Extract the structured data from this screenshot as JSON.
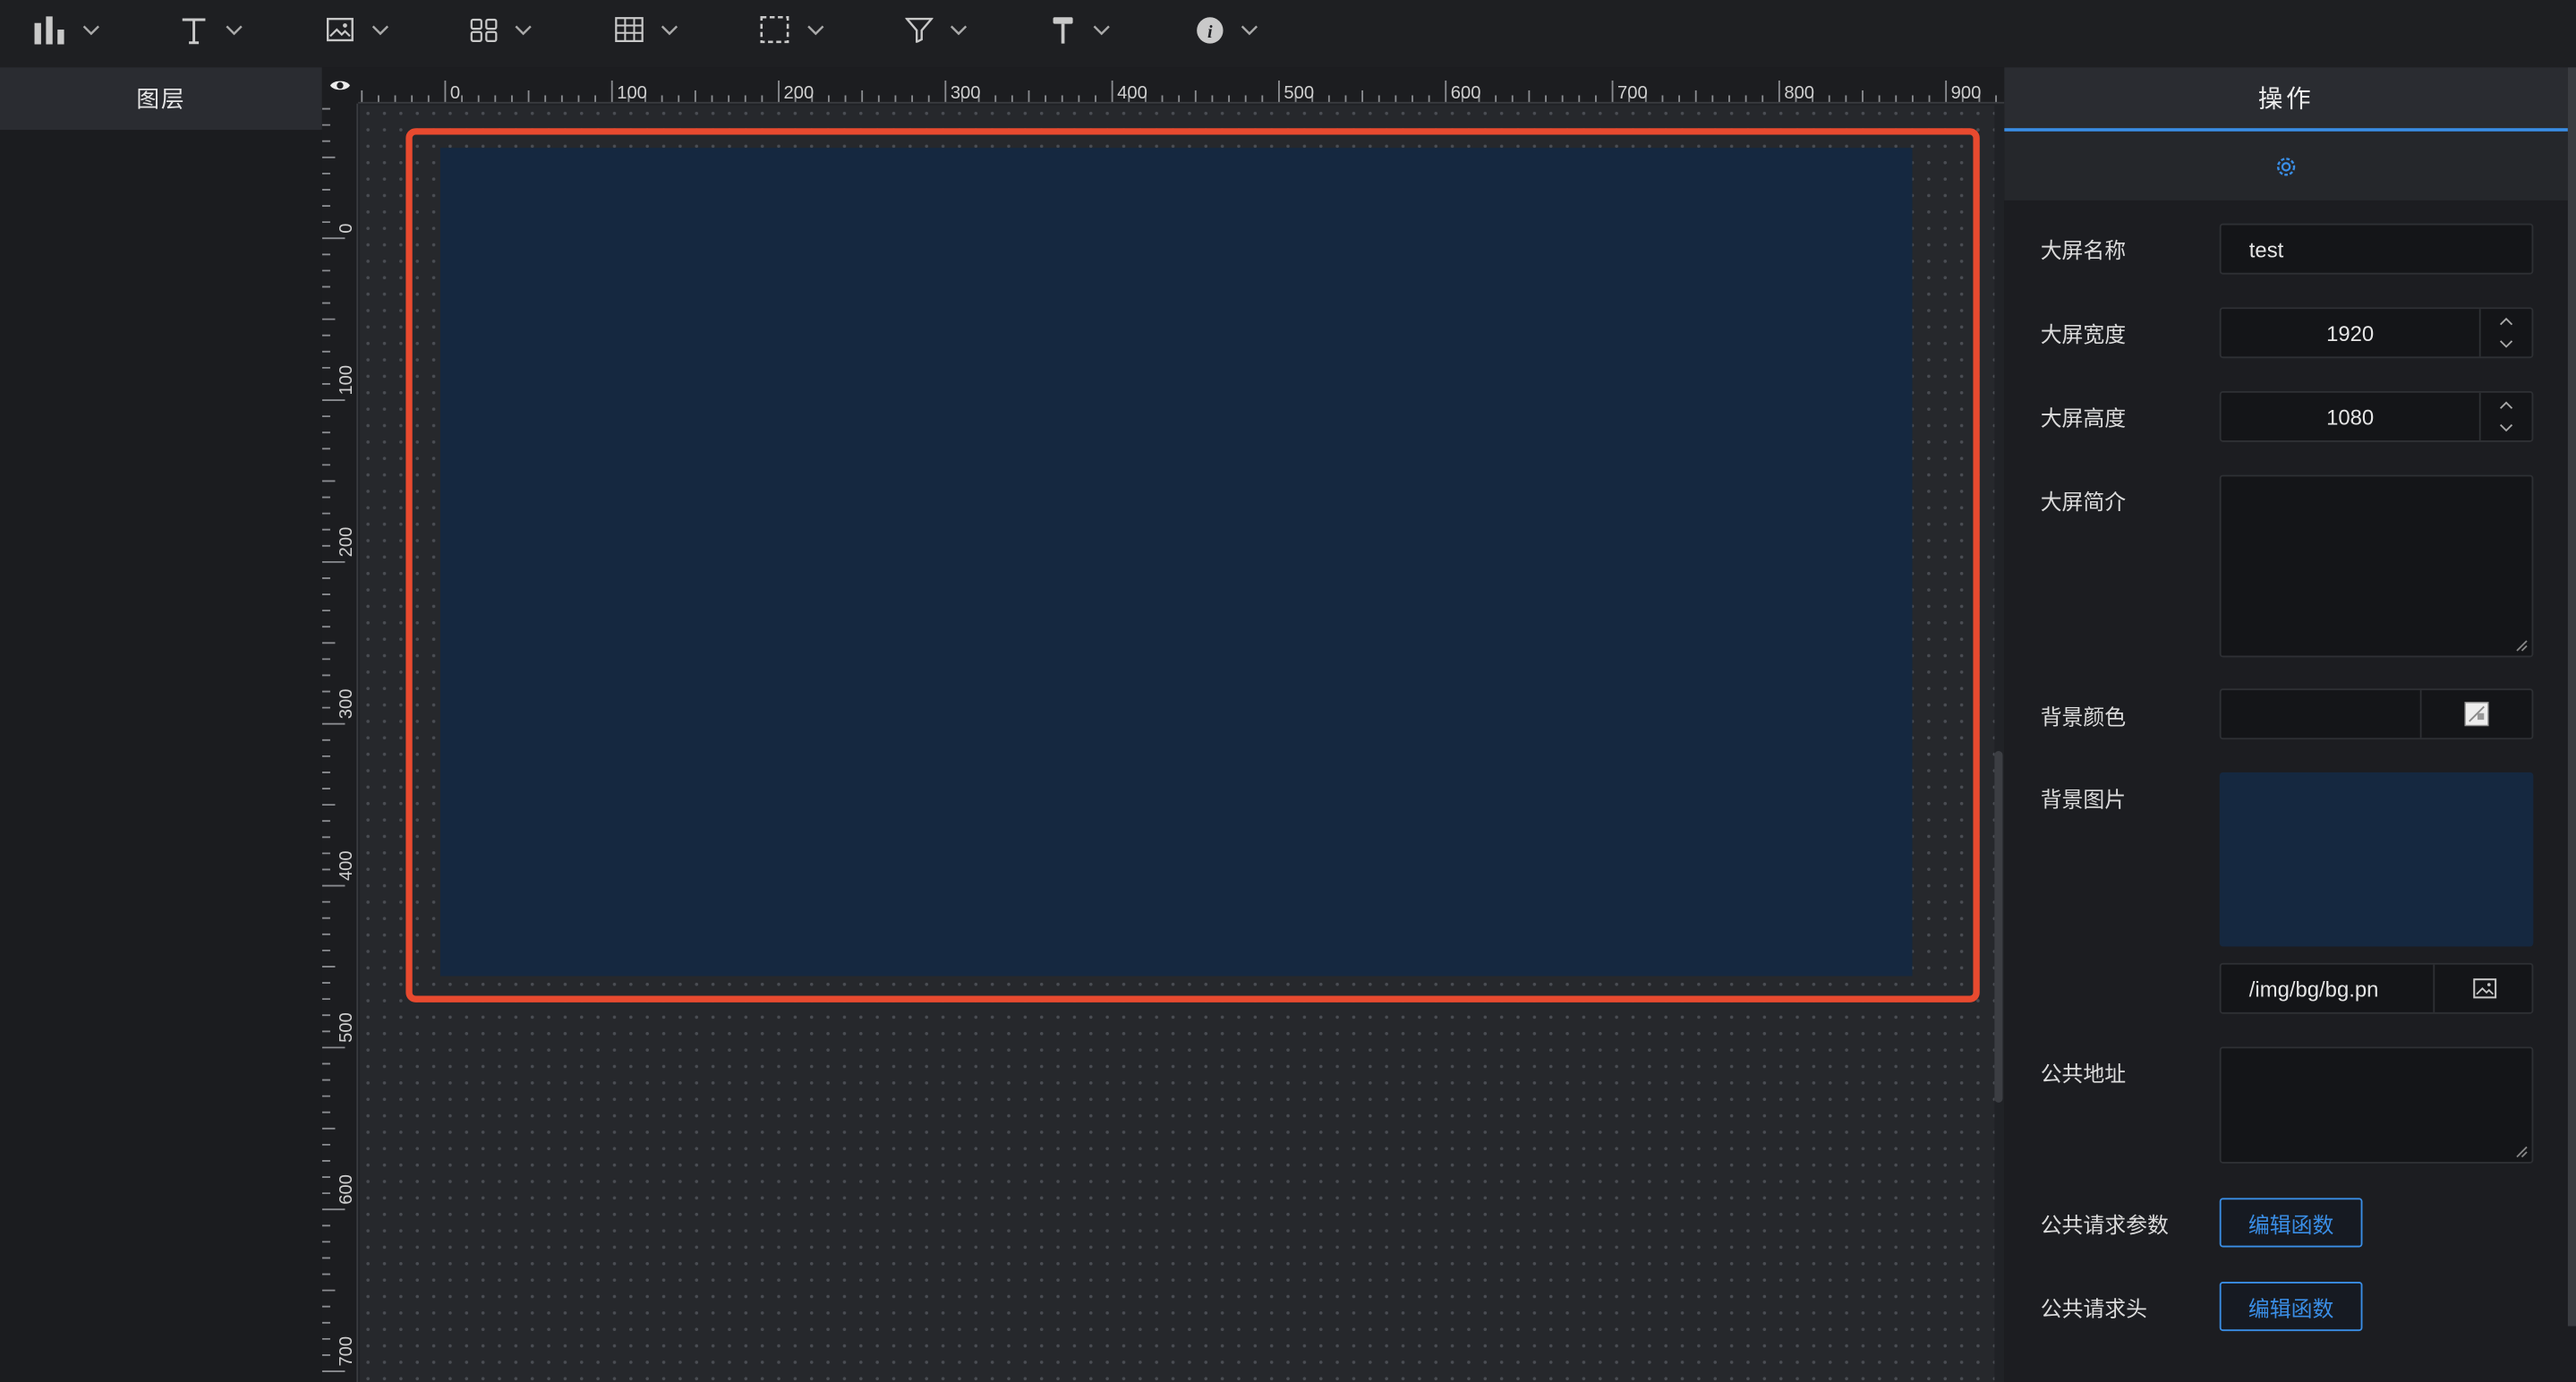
{
  "toolbar": {
    "tools": [
      {
        "name": "chart-tool",
        "icon": "bar-chart-icon"
      },
      {
        "name": "text-tool",
        "icon": "text-icon"
      },
      {
        "name": "image-tool",
        "icon": "image-icon"
      },
      {
        "name": "widget-tool",
        "icon": "grid-icon"
      },
      {
        "name": "table-tool",
        "icon": "table-icon"
      },
      {
        "name": "border-tool",
        "icon": "dashed-box-icon"
      },
      {
        "name": "filter-tool",
        "icon": "filter-icon"
      },
      {
        "name": "decoration-tool",
        "icon": "paint-roller-icon"
      },
      {
        "name": "info-tool",
        "icon": "info-icon"
      }
    ]
  },
  "layers_panel": {
    "title": "图层"
  },
  "ruler": {
    "top_labels": [
      "0",
      "100",
      "200",
      "300",
      "400",
      "500",
      "600",
      "700",
      "800",
      "900"
    ],
    "left_labels": [
      "0",
      "100",
      "200",
      "300",
      "400",
      "500",
      "600",
      "700"
    ]
  },
  "ops_panel": {
    "title": "操作",
    "settings_icon": "gear-icon",
    "fields": {
      "name_label": "大屏名称",
      "name_value": "test",
      "width_label": "大屏宽度",
      "width_value": "1920",
      "height_label": "大屏高度",
      "height_value": "1080",
      "intro_label": "大屏简介",
      "intro_value": "",
      "bgcolor_label": "背景颜色",
      "bgimage_label": "背景图片",
      "bgimage_path": "/img/bg/bg.pn",
      "public_url_label": "公共地址",
      "public_url_value": "",
      "req_params_label": "公共请求参数",
      "req_params_button": "编辑函数",
      "req_header_label": "公共请求头",
      "req_header_button": "编辑函数"
    }
  },
  "colors": {
    "accent": "#3a8ee6",
    "selection": "#e84a2f",
    "screen_bg": "#152840",
    "bg_image_preview": "#152840"
  }
}
